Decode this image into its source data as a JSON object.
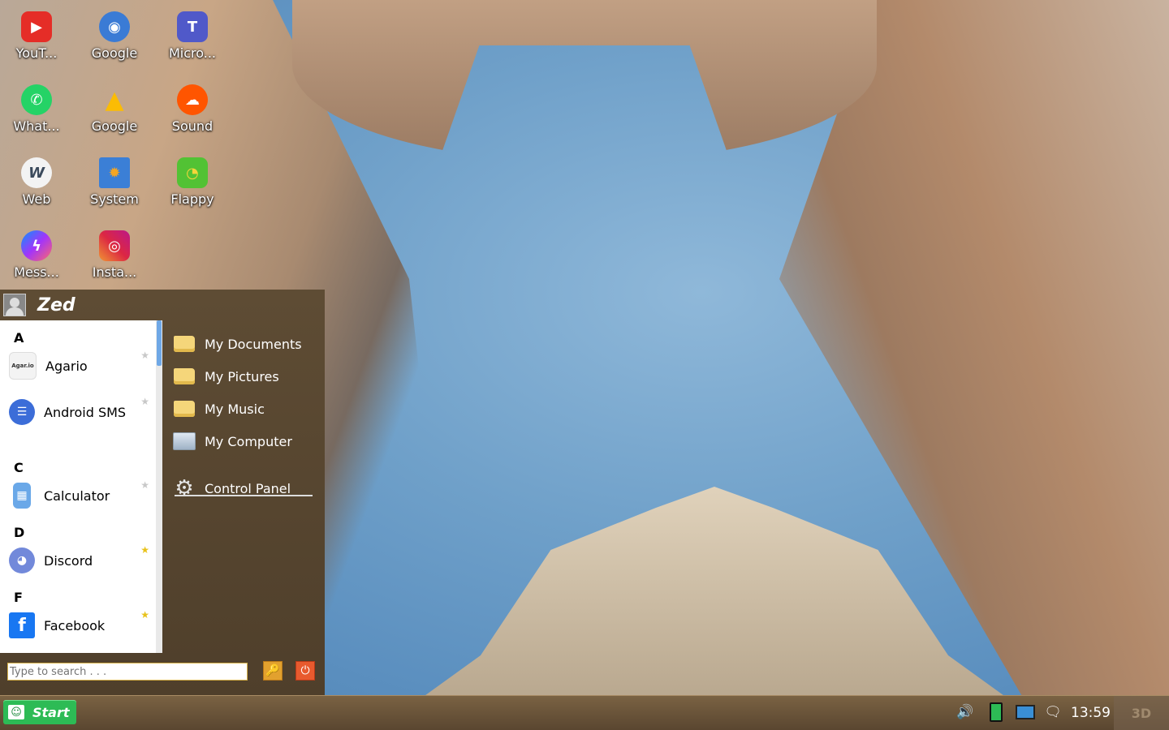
{
  "desktop": {
    "icons": [
      {
        "label": "YouT...",
        "icon": "youtube-icon",
        "color": "#e52d27",
        "glyph": "▶"
      },
      {
        "label": "Google",
        "icon": "google-earth-icon",
        "color": "#3a7bd5",
        "glyph": "◉"
      },
      {
        "label": "Micro...",
        "icon": "microsoft-teams-icon",
        "color": "#5059c9",
        "glyph": "T"
      },
      {
        "label": "What...",
        "icon": "whatsapp-icon",
        "color": "#25d366",
        "glyph": "✆"
      },
      {
        "label": "Google",
        "icon": "google-drive-icon",
        "color": "#fbbc04",
        "glyph": "▲"
      },
      {
        "label": "Sound",
        "icon": "soundcloud-icon",
        "color": "#ff5500",
        "glyph": "☁"
      },
      {
        "label": "Web",
        "icon": "web-icon",
        "color": "#3b4a5c",
        "glyph": "W"
      },
      {
        "label": "System",
        "icon": "system-icon",
        "color": "#3b7fd6",
        "glyph": "✹"
      },
      {
        "label": "Flappy",
        "icon": "flappy-bird-icon",
        "color": "#52c234",
        "glyph": "◔"
      },
      {
        "label": "Mess...",
        "icon": "messenger-icon",
        "color": "#8a3ffc",
        "glyph": "ϟ"
      },
      {
        "label": "Insta...",
        "icon": "instagram-icon",
        "color": "#d6249f",
        "glyph": "◎"
      }
    ]
  },
  "start_menu": {
    "user_name": "Zed",
    "groups": [
      {
        "letter": "A"
      },
      {
        "letter": "C"
      },
      {
        "letter": "D"
      },
      {
        "letter": "F"
      }
    ],
    "apps": [
      {
        "name": "Agario",
        "icon": "agario-icon",
        "favorite": false,
        "color": "#f3f3f3",
        "glyph": "Agar.io"
      },
      {
        "name": "Android SMS",
        "icon": "android-sms-icon",
        "favorite": false,
        "color": "#3c6dd8",
        "glyph": "☰"
      },
      {
        "name": "Calculator",
        "icon": "calculator-icon",
        "favorite": false,
        "color": "#6aa8e8",
        "glyph": "▦"
      },
      {
        "name": "Discord",
        "icon": "discord-icon",
        "favorite": true,
        "color": "#7289da",
        "glyph": "◕"
      },
      {
        "name": "Facebook",
        "icon": "facebook-icon",
        "favorite": true,
        "color": "#1877f2",
        "glyph": "f"
      }
    ],
    "places": [
      {
        "name": "My Documents",
        "icon": "documents-folder-icon"
      },
      {
        "name": "My Pictures",
        "icon": "pictures-folder-icon"
      },
      {
        "name": "My Music",
        "icon": "music-folder-icon"
      },
      {
        "name": "My Computer",
        "icon": "computer-icon"
      },
      {
        "name": "Control Panel",
        "icon": "control-panel-gear-icon"
      }
    ],
    "search_placeholder": "Type to search . . ."
  },
  "taskbar": {
    "start_label": "Start",
    "clock": "13:59",
    "btn_3d": "3D",
    "tray_icons": [
      "volume-icon",
      "battery-icon",
      "network-icon",
      "notifications-icon"
    ]
  },
  "colors": {
    "start_button": "#2dbb55",
    "menu_bg": "#5b4a33",
    "favorite_star": "#e8c21a"
  }
}
